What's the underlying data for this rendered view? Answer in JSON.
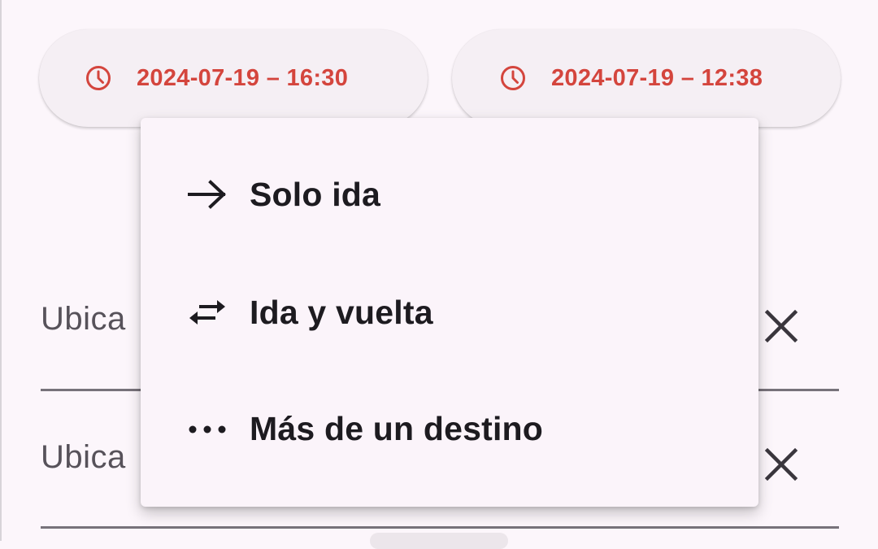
{
  "date_chips": [
    {
      "icon": "clock-icon",
      "label": "2024-07-19 – 16:30"
    },
    {
      "icon": "clock-icon",
      "label": "2024-07-19 – 12:38"
    }
  ],
  "fields": [
    {
      "value": "Ubica",
      "clear_icon": "close-icon"
    },
    {
      "value": "Ubica",
      "clear_icon": "close-icon"
    }
  ],
  "trip_menu": {
    "items": [
      {
        "icon": "arrow-right-icon",
        "label": "Solo ida"
      },
      {
        "icon": "swap-horizontal-icon",
        "label": "Ida y vuelta"
      },
      {
        "icon": "more-horizontal-icon",
        "label": "Más de un destino"
      }
    ]
  },
  "colors": {
    "accent": "#d4453d",
    "background": "#fcf6fb",
    "menu_background": "#fbf4fa",
    "text_primary": "#1d1b20",
    "text_secondary": "#57525a"
  }
}
